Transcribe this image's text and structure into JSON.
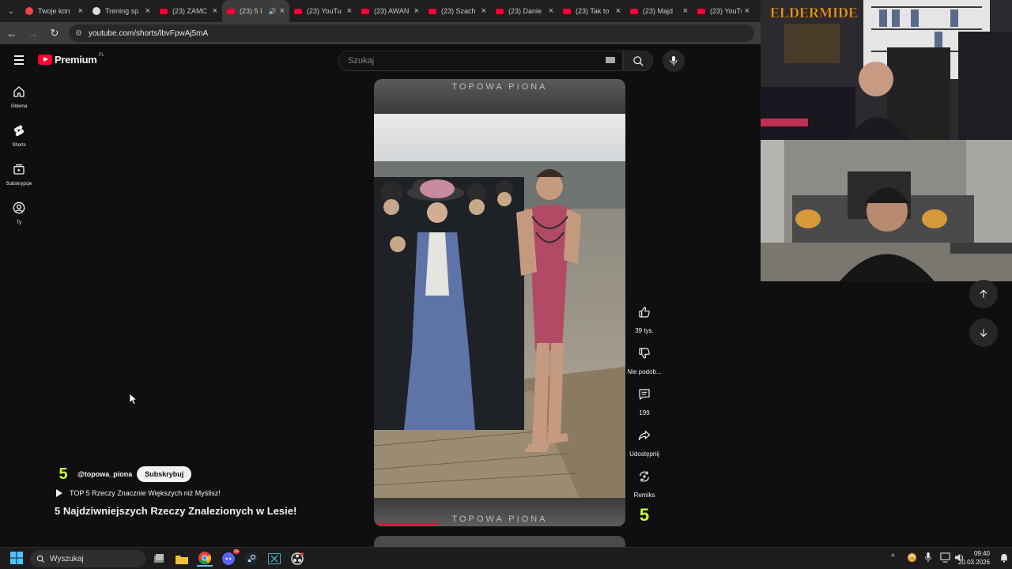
{
  "browser": {
    "tabs": [
      {
        "title": "Twoje kon",
        "icon": "circle-red-icon"
      },
      {
        "title": "Trening sp",
        "icon": "football-icon"
      },
      {
        "title": "(23) ZAMC",
        "icon": "youtube-icon"
      },
      {
        "title": "(23) 5 I",
        "icon": "youtube-icon",
        "active": true
      },
      {
        "title": "(23) YouTu",
        "icon": "youtube-icon"
      },
      {
        "title": "(23) AWAN",
        "icon": "youtube-icon"
      },
      {
        "title": "(23) Szach",
        "icon": "youtube-icon"
      },
      {
        "title": "(23) Danie",
        "icon": "youtube-icon"
      },
      {
        "title": "(23) Tak to",
        "icon": "youtube-icon"
      },
      {
        "title": "(23) Majd",
        "icon": "youtube-icon"
      },
      {
        "title": "(23) YouTu",
        "icon": "youtube-icon"
      }
    ],
    "url": "youtube.com/shorts/lbvFpwAj5mA"
  },
  "youtube": {
    "logo_text": "Premium",
    "logo_region": "PL",
    "search_placeholder": "Szukaj",
    "sidebar": [
      {
        "label": "Główna",
        "icon": "home-icon"
      },
      {
        "label": "Shorts",
        "icon": "shorts-icon"
      },
      {
        "label": "Subskrypcje",
        "icon": "subscriptions-icon"
      },
      {
        "label": "Ty",
        "icon": "account-icon"
      }
    ],
    "short": {
      "watermark_top": "TOPOWA PIONA",
      "watermark_bottom": "TOPOWA PIONA",
      "progress": 0.25,
      "channel_avatar": "5",
      "channel_handle": "@topowa_piona",
      "subscribe_label": "Subskrybuj",
      "playlist": "TOP 5 Rzeczy Znacznie Większych niż Myślisz!",
      "title": "5 Najdziwniejszych Rzeczy Znalezionych w Lesie!"
    },
    "actions": {
      "like": "39 tys.",
      "dislike": "Nie podob...",
      "comments": "199",
      "share": "Udostępnij",
      "remix": "Remiks",
      "channel_badge": "5"
    }
  },
  "webcams": {
    "cam1_overlay": "ELDERMIDE"
  },
  "taskbar": {
    "search_label": "Wyszukaj",
    "time": "09:40",
    "date": "20.03.2026",
    "discord_badge": "9+"
  },
  "colors": {
    "yt_red": "#ff0033",
    "channel_green": "#c6ff3a",
    "bg": "#0f0f0f"
  }
}
